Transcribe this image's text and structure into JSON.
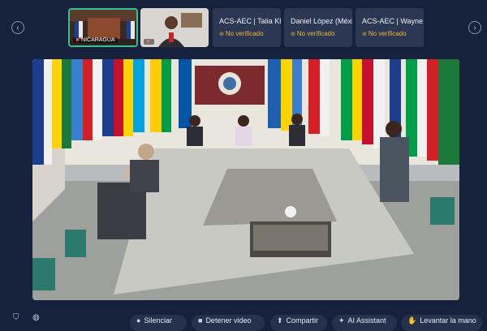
{
  "participants_strip": {
    "prev_label": "‹",
    "next_label": "›",
    "video_tiles": [
      {
        "caption": "NICARAGUA"
      }
    ],
    "participants": [
      {
        "name": "ACS-AEC | Talia Khan",
        "status": "No verificado"
      },
      {
        "name": "Daniel López (México)",
        "status": "No verificado"
      },
      {
        "name": "ACS-AEC | Wayne Ou…",
        "status": "No verificado"
      }
    ]
  },
  "toolbar": {
    "left_icons": [
      "shield-icon",
      "globe-icon"
    ],
    "buttons": [
      {
        "label": "Silenciar",
        "icon": "mic-icon"
      },
      {
        "label": "Detener video",
        "icon": "camera-icon"
      },
      {
        "label": "Compartir",
        "icon": "share-icon"
      },
      {
        "label": "AI Assistant",
        "icon": "sparkle-icon"
      },
      {
        "label": "Levantar la mano",
        "icon": "hand-icon"
      }
    ]
  },
  "colors": {
    "background": "#16213b",
    "tile": "#2b3753",
    "active_border": "#39c28f",
    "warning": "#e8b93c"
  }
}
